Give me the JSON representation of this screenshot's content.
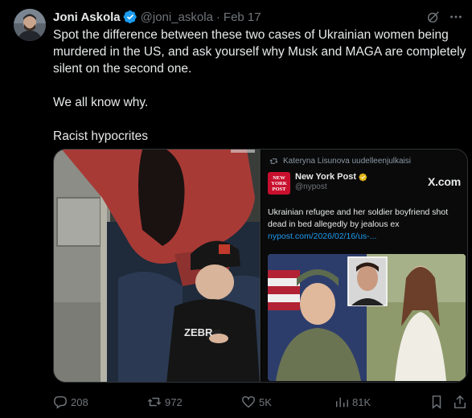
{
  "tweet": {
    "author_name": "Joni Askola",
    "handle": "@joni_askola",
    "separator": "·",
    "date": "Feb 17",
    "text_line1": "Spot the difference between these two cases of Ukrainian women being",
    "text_line2": "murdered in the US, and ask yourself why Musk and MAGA are completely",
    "text_line3": "silent on the second one.",
    "text_line4": "We all know why.",
    "text_line5": "Racist hypocrites"
  },
  "quoted": {
    "repost_label": "Kateryna Lisunova uudelleenjulkaisi",
    "logo_line1": "NEW",
    "logo_line2": "YORK",
    "logo_line3": "POST",
    "name": "New York Post",
    "handle": "@nypost",
    "brand": "X.com",
    "body_text": "Ukrainian refugee and her soldier boyfriend shot dead in bed allegedly by jealous ex ",
    "body_link": "nypost.com/2026/02/16/us-..."
  },
  "left_image": {
    "shirt_text": "ZEBR"
  },
  "actions": {
    "replies": "208",
    "reposts": "972",
    "likes": "5K",
    "views": "81K"
  },
  "icons": [
    "verified-badge-icon",
    "grok-icon",
    "more-icon",
    "reply-icon",
    "repost-icon",
    "like-icon",
    "views-icon",
    "bookmark-icon",
    "share-icon"
  ],
  "colors": {
    "background": "#000000",
    "text": "#e7e9ea",
    "muted": "#71767b",
    "link": "#1d9bf0",
    "verified": "#1d9bf0",
    "nypost_red": "#c8102e"
  }
}
